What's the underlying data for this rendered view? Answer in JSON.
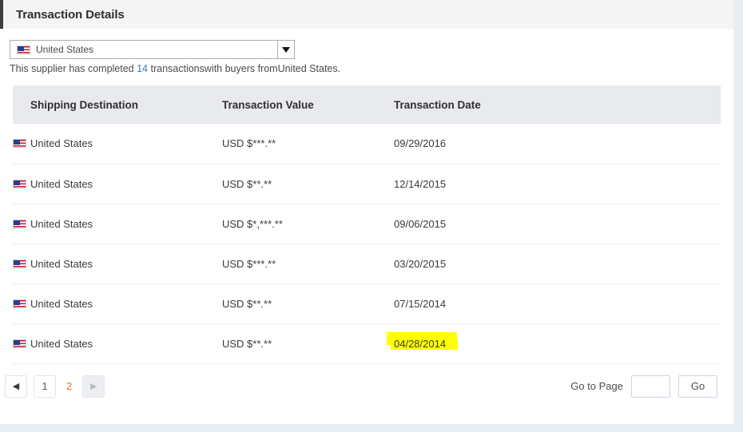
{
  "panel": {
    "title": "Transaction Details"
  },
  "filter": {
    "selected_country": "United States",
    "flag_icon": "us-flag-icon",
    "dropdown_icon": "chevron-down-icon",
    "summary": {
      "prefix": "This supplier has completed ",
      "count": "14",
      "suffix": " transactionswith buyers fromUnited States."
    }
  },
  "table": {
    "columns": [
      "Shipping Destination",
      "Transaction Value",
      "Transaction Date"
    ],
    "rows": [
      {
        "destination": "United States",
        "value": "USD $***.**",
        "date": "09/29/2016",
        "highlighted": false
      },
      {
        "destination": "United States",
        "value": "USD $**.**",
        "date": "12/14/2015",
        "highlighted": false
      },
      {
        "destination": "United States",
        "value": "USD $*,***.**",
        "date": "09/06/2015",
        "highlighted": false
      },
      {
        "destination": "United States",
        "value": "USD $***.**",
        "date": "03/20/2015",
        "highlighted": false
      },
      {
        "destination": "United States",
        "value": "USD $**.**",
        "date": "07/15/2014",
        "highlighted": false
      },
      {
        "destination": "United States",
        "value": "USD $**.**",
        "date": "04/28/2014",
        "highlighted": true
      }
    ]
  },
  "pagination": {
    "prev_label": "◀",
    "next_label": "▶",
    "page_1": "1",
    "page_2": "2",
    "active_page": "2",
    "goto_label": "Go to Page",
    "goto_value": "",
    "goto_placeholder": "",
    "go_button": "Go"
  },
  "colors": {
    "accent_orange": "#e8731e",
    "link_blue": "#3b78c3",
    "header_band": "#e9eaee",
    "highlight_yellow": "#ffff00"
  }
}
